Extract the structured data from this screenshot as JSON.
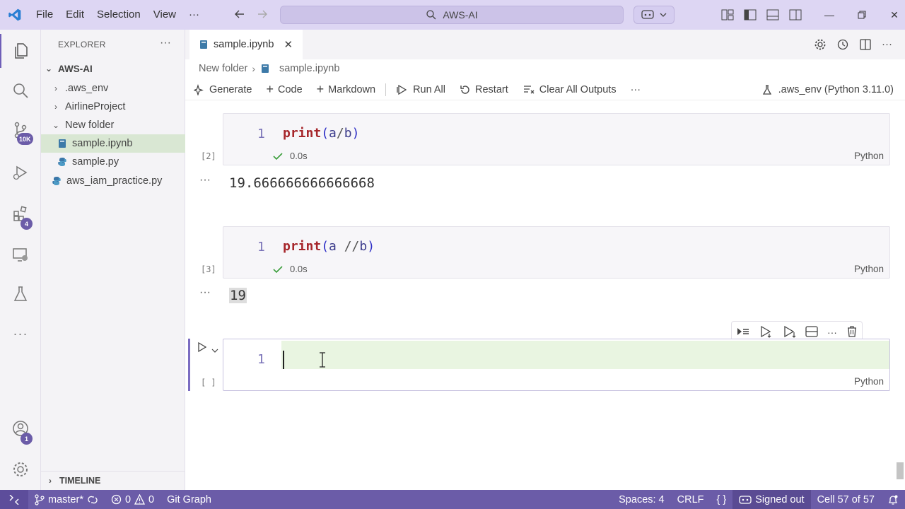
{
  "titlebar": {
    "menu": [
      "File",
      "Edit",
      "Selection",
      "View"
    ],
    "more": "···",
    "search": "AWS-AI"
  },
  "activity": {
    "source_control_badge": "10K",
    "extensions_badge": "4",
    "accounts_badge": "1"
  },
  "explorer": {
    "title": "EXPLORER",
    "more": "···",
    "root": "AWS-AI",
    "items": [
      {
        "label": ".aws_env"
      },
      {
        "label": "AirlineProject"
      },
      {
        "label": "New folder"
      },
      {
        "label": "sample.ipynb"
      },
      {
        "label": "sample.py"
      },
      {
        "label": "aws_iam_practice.py"
      }
    ],
    "timeline": "TIMELINE"
  },
  "tab": {
    "label": "sample.ipynb",
    "close": "✕"
  },
  "breadcrumb": {
    "folder": "New folder",
    "file": "sample.ipynb"
  },
  "toolbar": {
    "generate": "Generate",
    "code": "Code",
    "markdown": "Markdown",
    "run_all": "Run All",
    "restart": "Restart",
    "clear_outputs": "Clear All Outputs",
    "more": "···",
    "kernel": ".aws_env (Python 3.11.0)"
  },
  "cells": [
    {
      "line": "1",
      "fn": "print",
      "open": "(",
      "arg1": "a",
      "op": "/",
      "arg2": "b",
      "close": ")",
      "exec": "[2]",
      "time": "0.0s",
      "lang": "Python",
      "output": "19.666666666666668"
    },
    {
      "line": "1",
      "fn": "print",
      "open": "(",
      "arg1": "a ",
      "op": "//",
      "arg2": "b",
      "close": ")",
      "exec": "[3]",
      "time": "0.0s",
      "lang": "Python",
      "output": "19"
    },
    {
      "line": "1",
      "exec": "[ ]",
      "lang": "Python"
    }
  ],
  "output_dots": "···",
  "statusbar": {
    "branch": "master*",
    "errors": "0",
    "warnings": "0",
    "git_graph": "Git Graph",
    "spaces": "Spaces: 4",
    "eol": "CRLF",
    "braces": "{ }",
    "signed": "Signed out",
    "cell": "Cell 57 of 57"
  },
  "colors": {
    "titlebar": "#ddd6f3",
    "statusbar": "#6b5ca8",
    "selected_file": "#d9e7d3",
    "keyword": "#a6262b"
  }
}
